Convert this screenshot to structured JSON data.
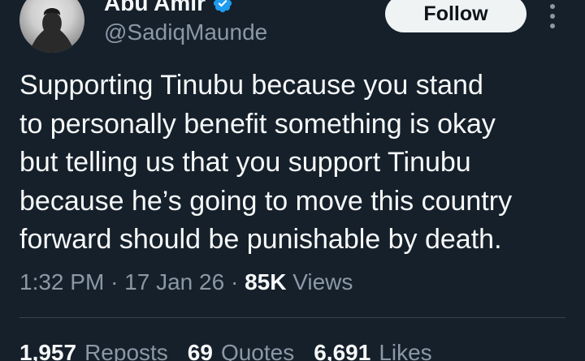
{
  "user": {
    "display_name": "Abu Amir",
    "handle": "@SadiqMaunde",
    "verified_icon": "verified-badge-icon",
    "verified_color": "#1d9bf0"
  },
  "actions": {
    "follow_label": "Follow",
    "more_icon": "more-vertical-icon"
  },
  "tweet": {
    "text": "Supporting Tinubu because you stand\nto personally benefit something is okay\nbut telling us that you support Tinubu\nbecause he’s going to move this country\nforward should be punishable by death.",
    "time": "1:32 PM",
    "sep1": "·",
    "date": "17 Jan 26",
    "sep2": "·",
    "views_count": "85K",
    "views_label": "Views"
  },
  "stats": {
    "reposts_count": "1,957",
    "reposts_label": "Reposts",
    "quotes_count": "69",
    "quotes_label": "Quotes",
    "likes_count": "6,691",
    "likes_label": "Likes"
  },
  "colors": {
    "background": "#15202b",
    "primary_text": "#f7f9f9",
    "secondary_text": "#8b98a5",
    "divider": "#38444d"
  }
}
